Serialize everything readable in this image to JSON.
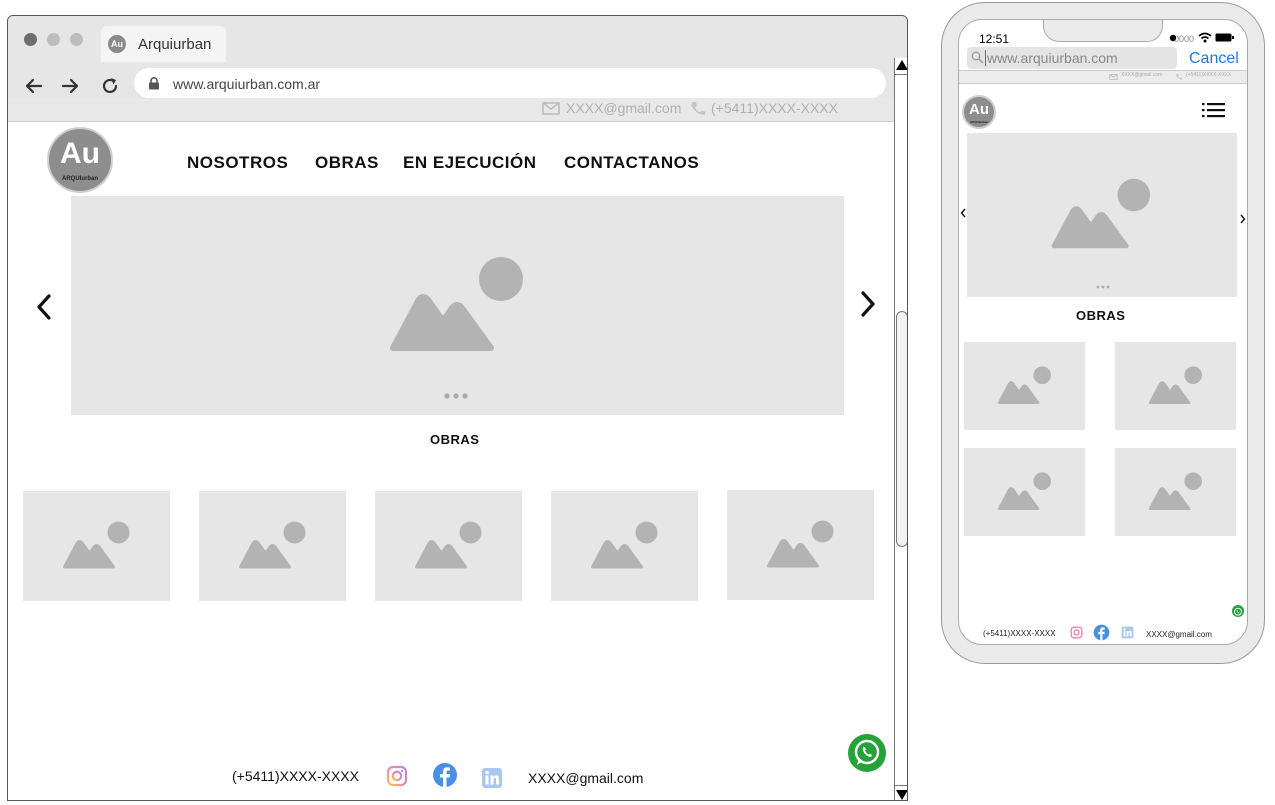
{
  "browser": {
    "tab_title": "Arquiurban",
    "url": "www.arquiurban.com.ar"
  },
  "site": {
    "logo_text": "Au",
    "logo_subtext": "ARQUIurban",
    "topbar": {
      "email": "XXXX@gmail.com",
      "phone": "(+5411)XXXX-XXXX"
    },
    "menu": [
      {
        "label": "NOSOTROS"
      },
      {
        "label": "OBRAS"
      },
      {
        "label": "EN EJECUCIÓN"
      },
      {
        "label": "CONTACTANOS"
      }
    ],
    "section_title": "OBRAS",
    "footer": {
      "phone": "(+5411)XXXX-XXXX",
      "email": "XXXX@gmail.com"
    }
  },
  "mobile": {
    "status_time": "12:51",
    "status_carrier": "0000",
    "url": "www.arquiurban.com",
    "cancel_label": "Cancel",
    "section_title": "OBRAS",
    "footer": {
      "phone": "(+5411)XXXX-XXXX",
      "email": "XXXX@gmail.com"
    }
  },
  "icons": {
    "placeholder": "image-placeholder-icon",
    "email": "mail-icon",
    "phone": "phone-icon",
    "instagram": "instagram-icon",
    "facebook": "facebook-icon",
    "linkedin": "linkedin-icon",
    "whatsapp": "whatsapp-icon",
    "menu": "hamburger-menu-icon"
  },
  "colors": {
    "placeholder_bg": "#e6e6e6",
    "placeholder_shape": "#b3b3b3",
    "whatsapp": "#25a23a",
    "facebook": "#4a90e2",
    "linkedin": "#7fa8d8",
    "cancel_blue": "#1f7ad6"
  }
}
